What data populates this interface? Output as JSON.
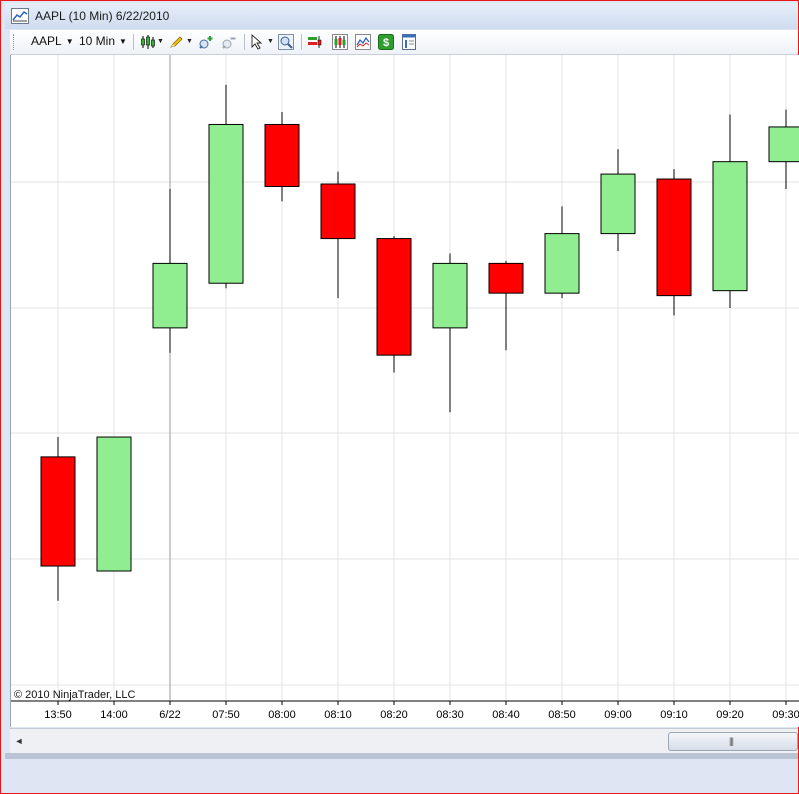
{
  "window": {
    "title": "AAPL (10 Min)  6/22/2010"
  },
  "toolbar": {
    "instrument": "AAPL",
    "interval": "10 Min",
    "icons": [
      "chart-style-icon",
      "drawing-tool-icon",
      "zoom-in-icon",
      "zoom-out-icon",
      "pointer-icon",
      "magnify-icon",
      "indicators-icon",
      "strategies-icon",
      "data-box-icon",
      "currency-icon",
      "properties-icon"
    ]
  },
  "chart": {
    "copyright": "© 2010 NinjaTrader, LLC",
    "colors": {
      "up": "#90ee90",
      "down": "#ff0000",
      "outline": "#000000",
      "grid": "#e3e3e3"
    }
  },
  "chart_data": {
    "type": "candlestick",
    "x_labels": [
      "13:50",
      "14:00",
      "6/22",
      "07:50",
      "08:00",
      "08:10",
      "08:20",
      "08:30",
      "08:40",
      "08:50",
      "09:00",
      "09:10",
      "09:20",
      "09:30"
    ],
    "candles": [
      {
        "label": "13:50",
        "open": 4.9,
        "close": 2.7,
        "high": 5.3,
        "low": 2.0
      },
      {
        "label": "14:00",
        "open": 2.6,
        "close": 5.3,
        "high": 5.3,
        "low": 2.6
      },
      {
        "label": "6/22",
        "open": 7.5,
        "close": 8.8,
        "high": 10.3,
        "low": 7.0
      },
      {
        "label": "07:50",
        "open": 8.4,
        "close": 11.6,
        "high": 12.4,
        "low": 8.3
      },
      {
        "label": "08:00",
        "open": 11.6,
        "close": 10.35,
        "high": 11.85,
        "low": 10.05
      },
      {
        "label": "08:10",
        "open": 10.4,
        "close": 9.3,
        "high": 10.65,
        "low": 8.1
      },
      {
        "label": "08:20",
        "open": 9.3,
        "close": 6.95,
        "high": 9.35,
        "low": 6.6
      },
      {
        "label": "08:30",
        "open": 7.5,
        "close": 8.8,
        "high": 9.0,
        "low": 5.8
      },
      {
        "label": "08:40",
        "open": 8.8,
        "close": 8.2,
        "high": 8.85,
        "low": 7.05
      },
      {
        "label": "08:50",
        "open": 8.2,
        "close": 9.4,
        "high": 9.95,
        "low": 8.1
      },
      {
        "label": "09:00",
        "open": 9.4,
        "close": 10.6,
        "high": 11.1,
        "low": 9.05
      },
      {
        "label": "09:10",
        "open": 10.5,
        "close": 8.15,
        "high": 10.7,
        "low": 7.75
      },
      {
        "label": "09:20",
        "open": 8.25,
        "close": 10.85,
        "high": 11.8,
        "low": 7.9
      },
      {
        "label": "09:30",
        "open": 10.85,
        "close": 11.55,
        "high": 11.9,
        "low": 10.3
      }
    ],
    "y_range": [
      0,
      13
    ],
    "grid": true,
    "axis_labels_visible": false
  }
}
